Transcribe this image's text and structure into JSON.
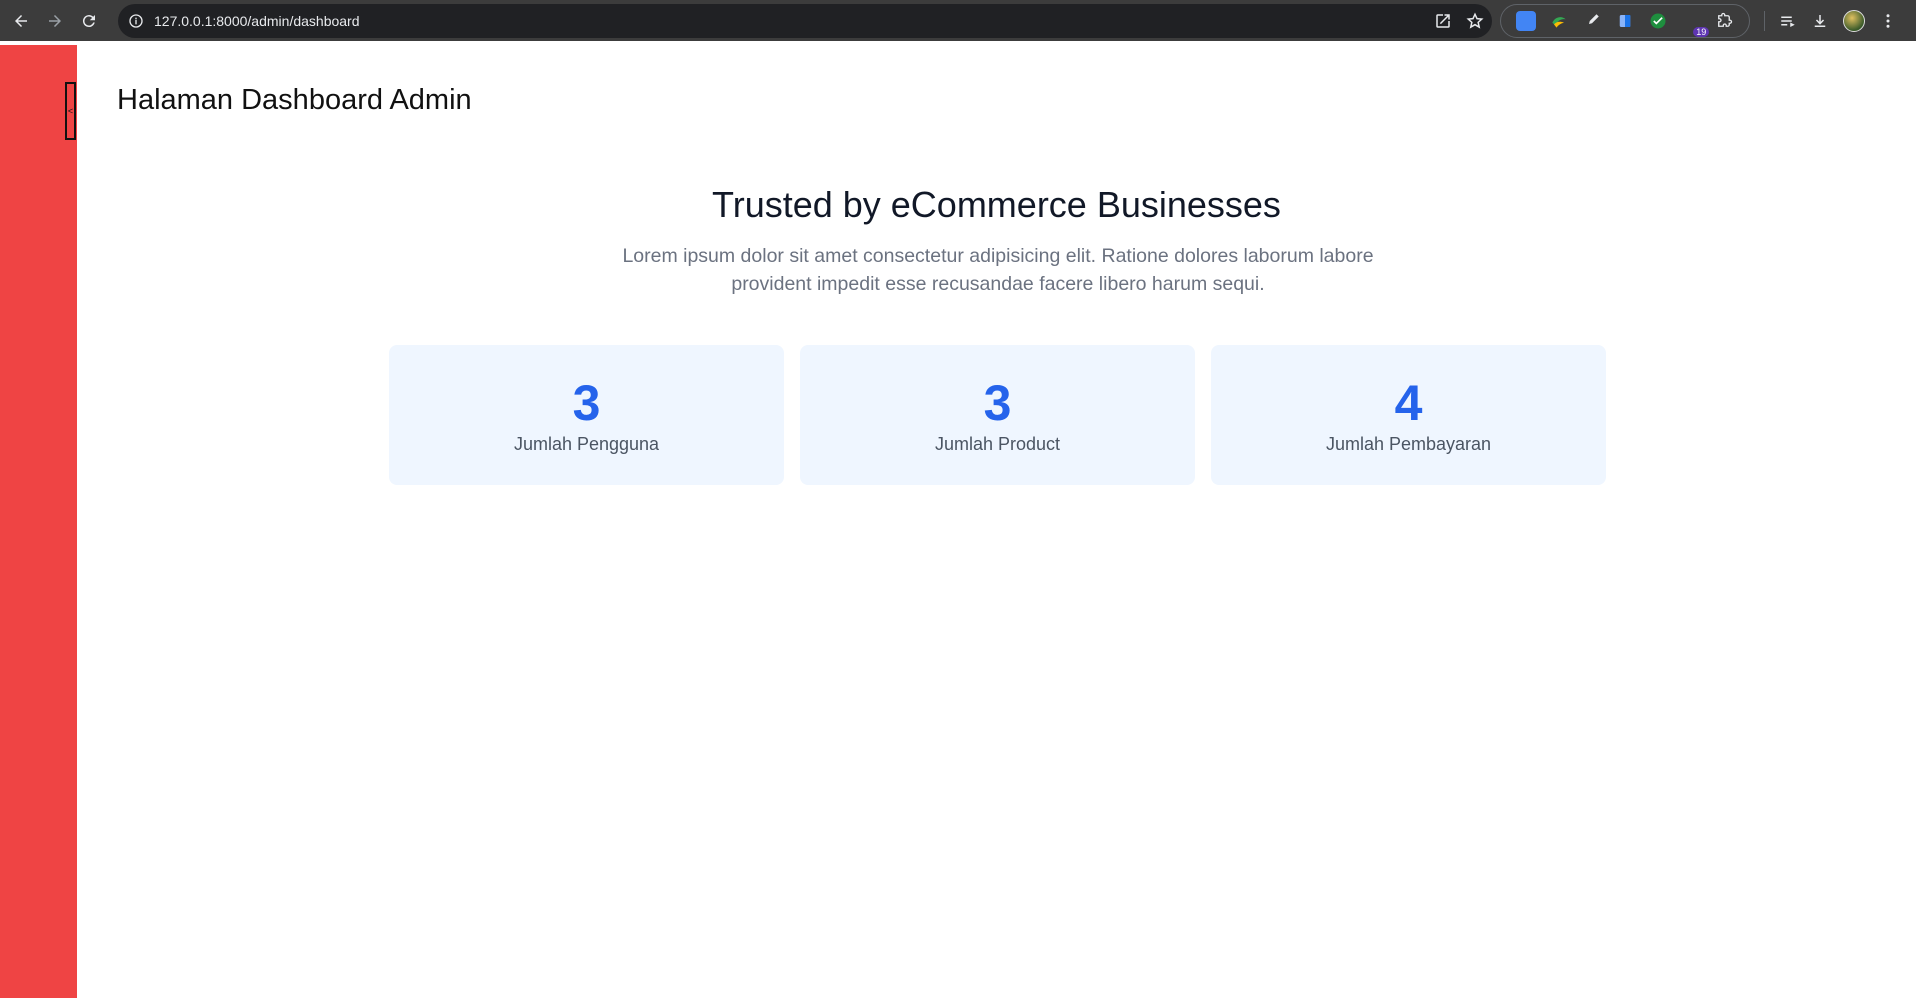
{
  "browser": {
    "url": "127.0.0.1:8000/admin/dashboard",
    "extensions_badge": "19"
  },
  "page": {
    "title": "Halaman Dashboard Admin",
    "sidebar_toggle": "<",
    "hero": {
      "heading": "Trusted by eCommerce Businesses",
      "description": "Lorem ipsum dolor sit amet consectetur adipisicing elit. Ratione dolores laborum labore provident impedit esse recusandae facere libero harum sequi."
    },
    "stats": [
      {
        "value": "3",
        "label": "Jumlah Pengguna"
      },
      {
        "value": "3",
        "label": "Jumlah Product"
      },
      {
        "value": "4",
        "label": "Jumlah Pembayaran"
      }
    ]
  },
  "colors": {
    "sidebar": "#ef4444",
    "stat_value": "#2563eb",
    "stat_card_bg": "#eff6ff"
  }
}
